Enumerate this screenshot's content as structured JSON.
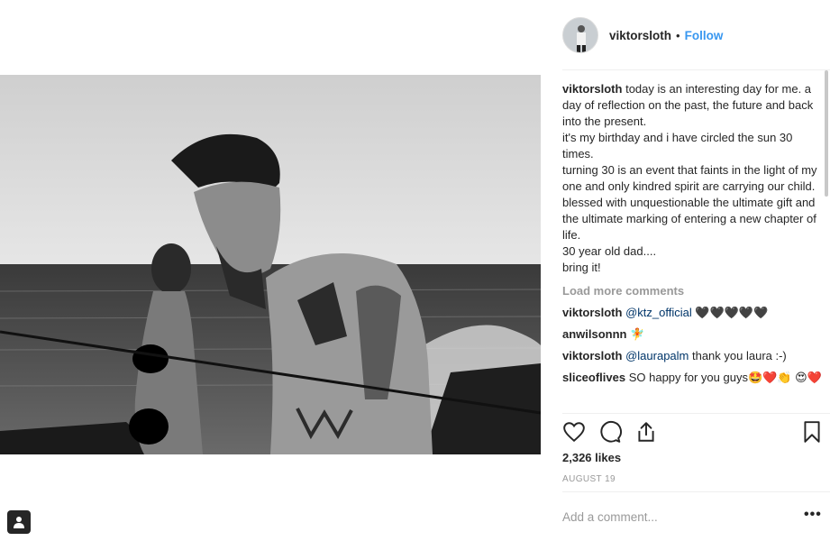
{
  "post": {
    "username": "viktorsloth",
    "separator": "•",
    "follow_label": "Follow"
  },
  "caption": {
    "username": "viktorsloth",
    "text": "today is an interesting day for me. a day of reflection on the past, the future and back into the present.\nit's my birthday and i have circled the sun 30 times.\nturning 30 is an event that faints in the light of my one and only kindred spirit are carrying our child. blessed with unquestionable the ultimate gift and the ultimate marking of entering a new chapter of life.\n30 year old dad....\nbring it!"
  },
  "load_more_label": "Load more comments",
  "comments": [
    {
      "username": "viktorsloth",
      "mention": "@ktz_official",
      "text": " 🖤🖤🖤🖤🖤"
    },
    {
      "username": "anwilsonnn",
      "mention": "",
      "text": " 🧚"
    },
    {
      "username": "viktorsloth",
      "mention": "@laurapalm",
      "text": " thank you laura :-)"
    },
    {
      "username": "sliceoflives",
      "mention": "",
      "text": " SO happy for you guys🤩❤️👏 😍❤️"
    }
  ],
  "icons": {
    "like": "heart-icon",
    "comment": "comment-icon",
    "share": "share-icon",
    "save": "bookmark-icon",
    "more": "more-options-icon",
    "badge": "user-tag-icon"
  },
  "likes": "2,326 likes",
  "date": "AUGUST 19",
  "add_comment_placeholder": "Add a comment...",
  "more_label": "•••",
  "colors": {
    "link": "#3897f0",
    "mention": "#003569",
    "muted": "#999999",
    "text": "#262626"
  }
}
